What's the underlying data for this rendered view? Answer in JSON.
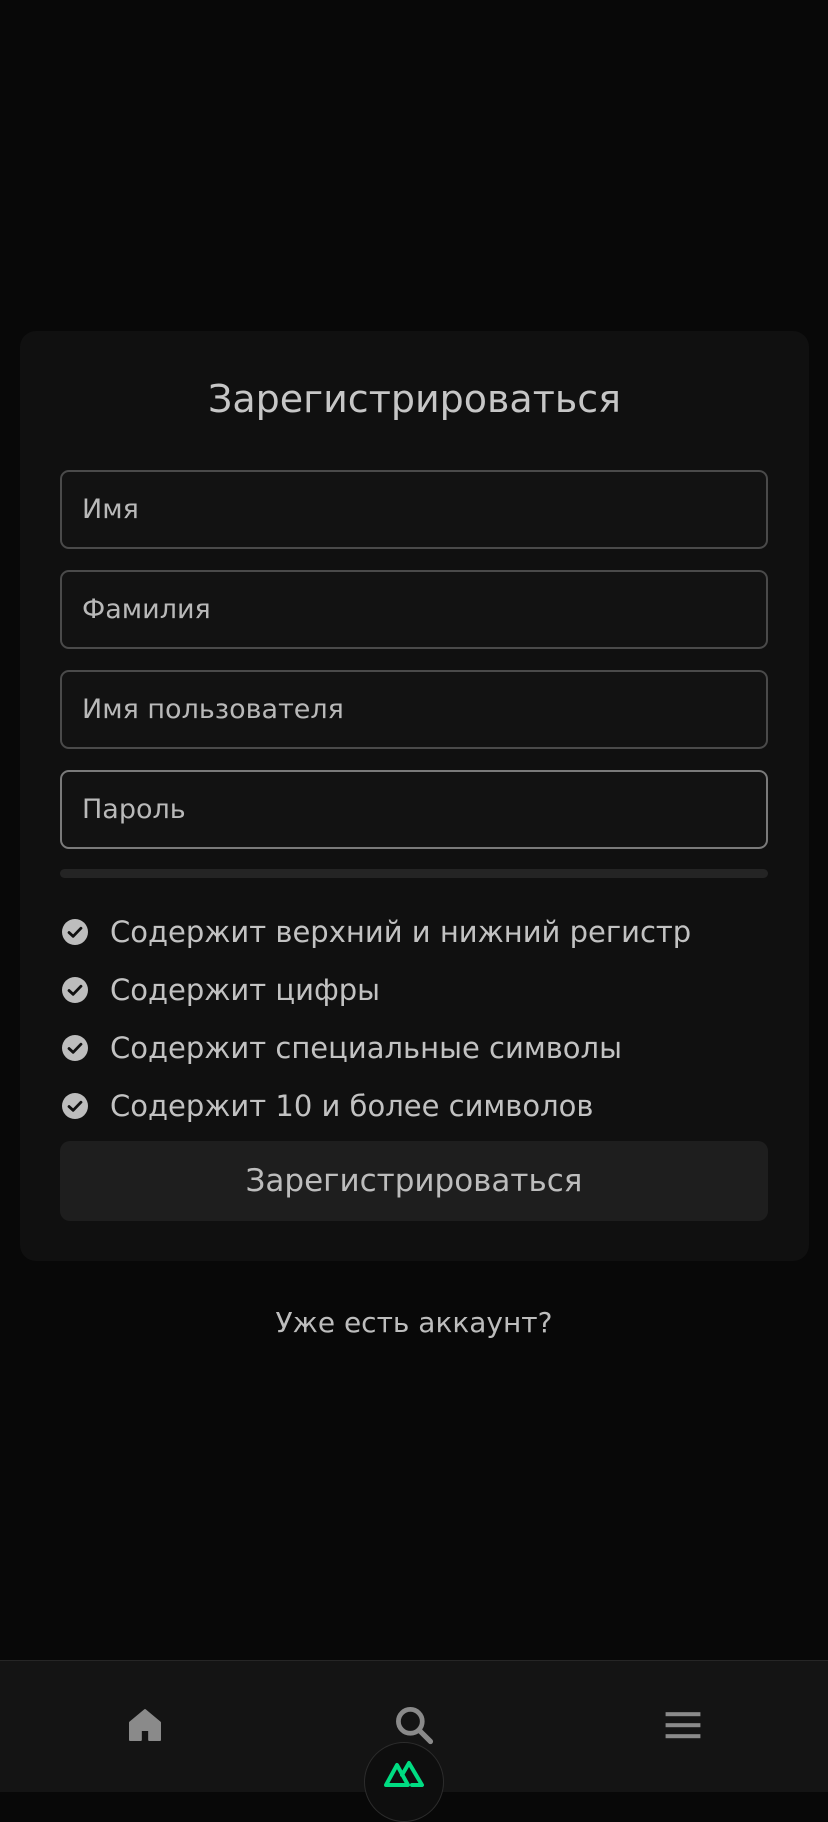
{
  "form": {
    "title": "Зарегистрироваться",
    "fields": {
      "first_name": {
        "placeholder": "Имя",
        "value": ""
      },
      "last_name": {
        "placeholder": "Фамилия",
        "value": ""
      },
      "username": {
        "placeholder": "Имя пользователя",
        "value": ""
      },
      "password": {
        "placeholder": "Пароль",
        "value": ""
      }
    },
    "password_strength_percent": 0,
    "requirements": [
      {
        "label": "Содержит верхний и нижний регистр",
        "icon": "check-circle-icon"
      },
      {
        "label": "Содержит цифры",
        "icon": "check-circle-icon"
      },
      {
        "label": "Содержит специальные символы",
        "icon": "check-circle-icon"
      },
      {
        "label": "Содержит 10 и более символов",
        "icon": "check-circle-icon"
      }
    ],
    "submit_label": "Зарегистрироваться"
  },
  "login_link": "Уже есть аккаунт?",
  "bottom_nav": {
    "items": [
      {
        "icon": "home-icon"
      },
      {
        "icon": "search-icon"
      },
      {
        "icon": "menu-icon"
      }
    ],
    "fab_icon": "nuxt-logo-icon",
    "fab_color": "#00dc82"
  },
  "colors": {
    "background": "#080808",
    "card": "#101010",
    "text": "#c8c8c8"
  }
}
